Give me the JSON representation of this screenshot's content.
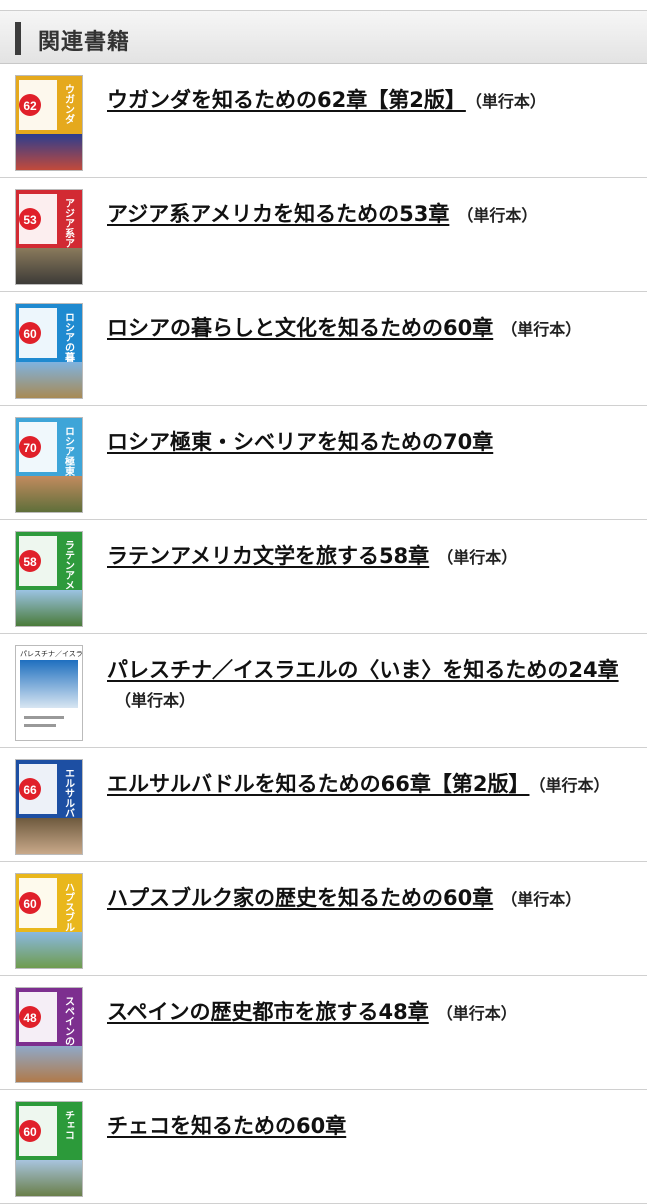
{
  "section": {
    "title": "関連書籍"
  },
  "books": [
    {
      "title": "ウガンダを知るための62章【第2版】",
      "format": "（単行本）",
      "cover_number": "62",
      "cover_text": "ウガンダ",
      "band_color": "#e5a91d",
      "badge_color": "#e0202a",
      "photo_top": "#2b3d8f",
      "photo_bottom": "#c24a3b"
    },
    {
      "title": "アジア系アメリカを知るための53章",
      "format": "（単行本）",
      "cover_number": "53",
      "cover_text": "アジア系アメリカ",
      "band_color": "#d22a33",
      "badge_color": "#e0202a",
      "photo_top": "#8a7a5c",
      "photo_bottom": "#3d3b38"
    },
    {
      "title": "ロシアの暮らしと文化を知るための60章",
      "format": "（単行本）",
      "cover_number": "60",
      "cover_text": "ロシアの暮らしと文化",
      "band_color": "#1f8ad0",
      "badge_color": "#e0202a",
      "photo_top": "#7fb3e0",
      "photo_bottom": "#a88a54"
    },
    {
      "title": "ロシア極東・シベリアを知るための70章",
      "format": "",
      "cover_number": "70",
      "cover_text": "ロシア極東・シベリア",
      "band_color": "#3ea5d8",
      "badge_color": "#e0202a",
      "photo_top": "#c28b5f",
      "photo_bottom": "#5f6f3a"
    },
    {
      "title": "ラテンアメリカ文学を旅する58章",
      "format": "（単行本）",
      "cover_number": "58",
      "cover_text": "ラテンアメリカ文学",
      "band_color": "#2e9a3c",
      "badge_color": "#e0202a",
      "photo_top": "#9bc3e3",
      "photo_bottom": "#4a7b3a"
    },
    {
      "title": "パレスチナ／イスラエルの〈いま〉を知るための24章",
      "format": "（単行本）",
      "cover_number": "",
      "cover_text": "パレスチナ／イスラエル",
      "band_color": "#ffffff",
      "badge_color": "#ffffff",
      "photo_top": "#1e6fbf",
      "photo_bottom": "#d8e6f2"
    },
    {
      "title": "エルサルバドルを知るための66章【第2版】",
      "format": "（単行本）",
      "cover_number": "66",
      "cover_text": "エルサルバドル",
      "band_color": "#1d4fa3",
      "badge_color": "#e0202a",
      "photo_top": "#6e5a3e",
      "photo_bottom": "#c9a98a"
    },
    {
      "title": "ハプスブルク家の歴史を知るための60章",
      "format": "（単行本）",
      "cover_number": "60",
      "cover_text": "ハプスブルク家の歴史",
      "band_color": "#e9b71c",
      "badge_color": "#e0202a",
      "photo_top": "#8ab8e0",
      "photo_bottom": "#6f9c4e"
    },
    {
      "title": "スペインの歴史都市を旅する48章",
      "format": "（単行本）",
      "cover_number": "48",
      "cover_text": "スペインの歴史都市",
      "band_color": "#7d2f8f",
      "badge_color": "#e0202a",
      "photo_top": "#8fa9c9",
      "photo_bottom": "#b07a4a"
    },
    {
      "title": "チェコを知るための60章",
      "format": "",
      "cover_number": "60",
      "cover_text": "チェコ",
      "band_color": "#2c9a3a",
      "badge_color": "#e0202a",
      "photo_top": "#a8c4de",
      "photo_bottom": "#6a7f4a"
    }
  ]
}
